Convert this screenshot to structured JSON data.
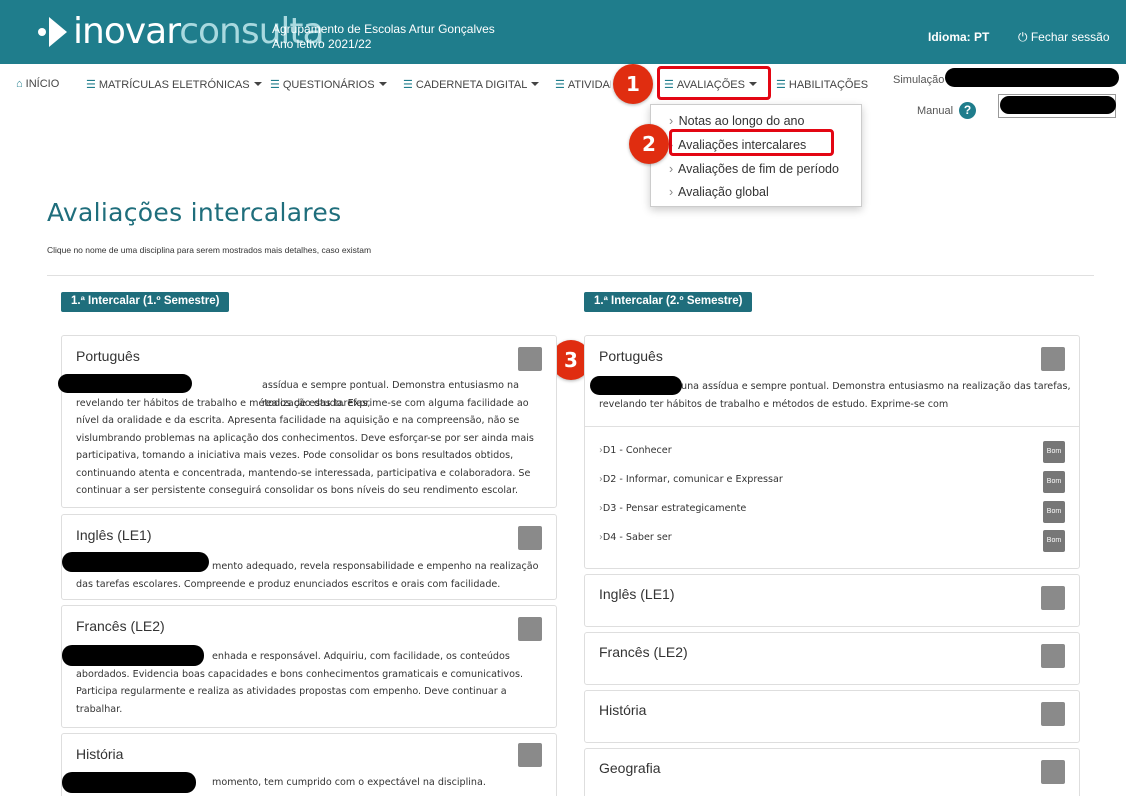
{
  "header": {
    "logo_bold": "inovar",
    "logo_light": "consulta",
    "school_name": "Agrupamento de Escolas Artur Gonçalves",
    "school_year": "Ano letivo 2021/22",
    "language": "Idioma: PT",
    "logout": "Fechar sessão"
  },
  "nav": {
    "inicio": "INÍCIO",
    "matriculas": "MATRÍCULAS ELETRÓNICAS",
    "questionarios": "QUESTIONÁRIOS",
    "caderneta": "CADERNETA DIGITAL",
    "atividades": "ATIVIDADES",
    "avaliacoes": "AVALIAÇÕES",
    "habilitacoes": "HABILITAÇÕES",
    "simulacao": "Simulação",
    "manual": "Manual"
  },
  "dropdown": {
    "items": [
      "Notas ao longo do ano",
      "Avaliações intercalares",
      "Avaliações de fim de período",
      "Avaliação global"
    ]
  },
  "annotations": [
    "1",
    "2",
    "3"
  ],
  "page": {
    "title": "Avaliações intercalares",
    "subtitle": "Clique no nome de uma disciplina para serem mostrados mais detalhes, caso existam"
  },
  "left": {
    "label": "1.ª Intercalar (1.º Semestre)",
    "panels": [
      {
        "title": "Português",
        "lines": [
          "assídua e sempre pontual. Demonstra entusiasmo na realização das tarefas,",
          "revelando ter hábitos de trabalho e métodos de estudo. Exprime-se com alguma facilidade ao",
          "nível da oralidade e da escrita. Apresenta facilidade na aquisição e na compreensão, não se",
          "vislumbrando problemas na aplicação dos conhecimentos. Deve esforçar-se por ser ainda mais",
          "participativa, tomando a iniciativa mais vezes. Pode consolidar os bons resultados obtidos,",
          "continuando atenta e concentrada, mantendo-se interessada, participativa e colaboradora. Se",
          "continuar a ser persistente conseguirá consolidar os bons níveis do seu rendimento escolar."
        ]
      },
      {
        "title": "Inglês (LE1)",
        "lines": [
          "mento adequado, revela responsabilidade e empenho na realização",
          "das tarefas escolares. Compreende e produz enunciados escritos e orais com facilidade."
        ]
      },
      {
        "title": "Francês (LE2)",
        "lines": [
          "enhada e responsável. Adquiriu, com facilidade, os conteúdos",
          "abordados. Evidencia boas capacidades e bons conhecimentos gramaticais e comunicativos.",
          "Participa regularmente e realiza as atividades propostas com empenho. Deve continuar a",
          "trabalhar."
        ]
      },
      {
        "title": "História",
        "lines": [
          "momento, tem cumprido com o expectável na disciplina."
        ]
      }
    ]
  },
  "right": {
    "label": "1.ª Intercalar (2.º Semestre)",
    "portugues": {
      "title": "Português",
      "lines": [
        "una assídua e sempre pontual. Demonstra entusiasmo na realização das tarefas,",
        "revelando ter hábitos de trabalho e métodos de estudo. Exprime-se com"
      ],
      "domains": [
        {
          "name": "D1 - Conhecer",
          "grade": "Bom"
        },
        {
          "name": "D2 - Informar, comunicar e Expressar",
          "grade": "Bom"
        },
        {
          "name": "D3 - Pensar estrategicamente",
          "grade": "Bom"
        },
        {
          "name": "D4 - Saber ser",
          "grade": "Bom"
        }
      ]
    },
    "others": [
      "Inglês (LE1)",
      "Francês (LE2)",
      "História",
      "Geografia"
    ]
  }
}
